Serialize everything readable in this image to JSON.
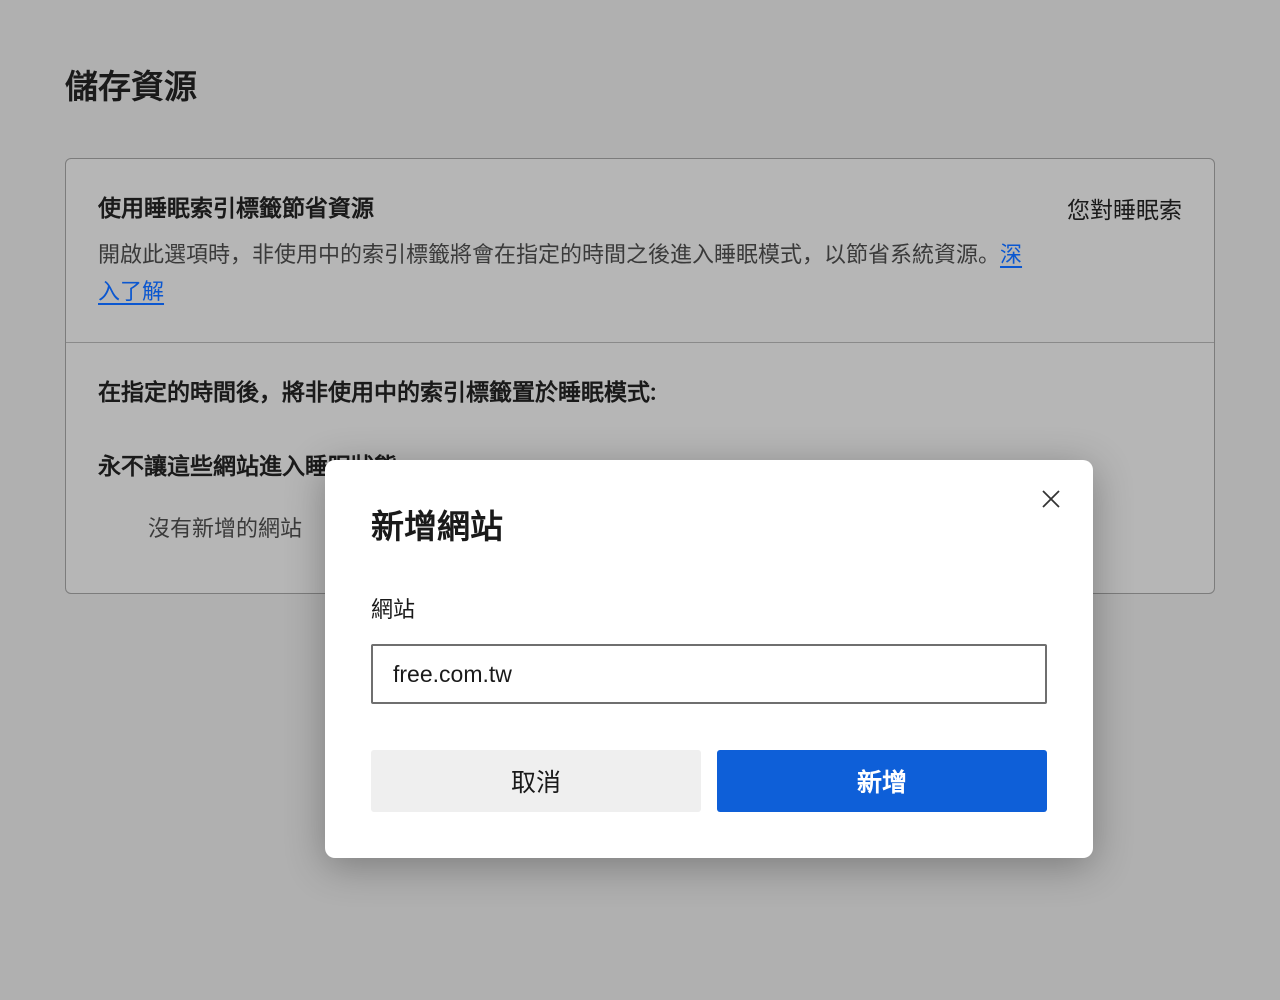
{
  "page": {
    "title": "儲存資源"
  },
  "card": {
    "section1": {
      "title": "使用睡眠索引標籤節省資源",
      "desc_before_link": "開啟此選項時，非使用中的索引標籤將會在指定的時間之後進入睡眠模式，以節省系統資源。",
      "learn_more": "深入了解",
      "right_text": "您對睡眠索"
    },
    "section2": {
      "heading1": "在指定的時間後，將非使用中的索引標籤置於睡眠模式:",
      "heading2": "永不讓這些網站進入睡眠狀態",
      "empty": "沒有新增的網站"
    }
  },
  "dialog": {
    "title": "新增網站",
    "field_label": "網站",
    "field_value": "free.com.tw",
    "cancel": "取消",
    "confirm": "新增"
  }
}
